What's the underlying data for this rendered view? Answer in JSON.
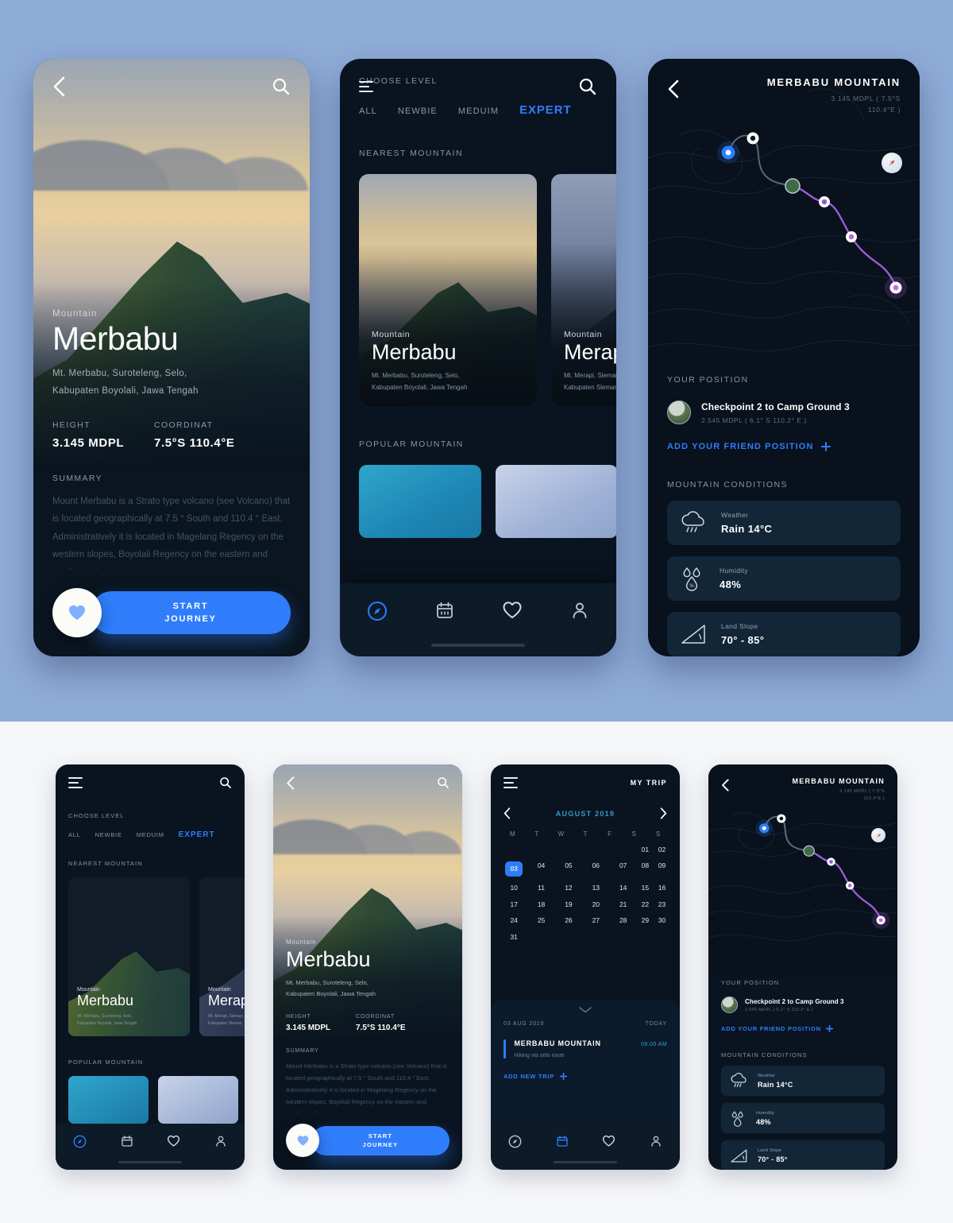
{
  "canvas": {
    "top_bg": "#8fabd8",
    "bottom_bg": "#f5f6f8",
    "accent": "#2f7dfb",
    "teal": "#2b9fc9"
  },
  "detail": {
    "back_icon": "chevron-left-icon",
    "search_icon": "search-icon",
    "kicker": "Mountain",
    "title": "Merbabu",
    "address_line1": "Mt. Merbabu, Suroteleng, Selo,",
    "address_line2": "Kabupaten Boyolali, Jawa Tengah",
    "height_label": "HEIGHT",
    "height_value": "3.145 MDPL",
    "coordinate_label": "COORDINAT",
    "coordinate_value": "7.5°S 110.4°E",
    "summary_label": "SUMMARY",
    "summary_body": "Mount Merbabu is a Strato type volcano (see Volcano) that is located geographically at 7.5 ° South and 110.4 ° East. Administratively it is located in Magelang Regency on the western slopes, Boyolali Regency on the eastern and southern slopes.",
    "favorite_icon": "heart-icon",
    "start_line1": "START",
    "start_line2": "JOURNEY"
  },
  "list": {
    "menu_icon": "hamburger-menu-icon",
    "search_icon": "search-icon",
    "choose_level_label": "CHOOSE LEVEL",
    "levels": [
      "ALL",
      "NEWBIE",
      "MEDUIM",
      "EXPERT"
    ],
    "active_level": "EXPERT",
    "nearest_label": "NEAREST MOUNTAIN",
    "nearest_cards": [
      {
        "kicker": "Mountain",
        "title": "Merbabu",
        "address_line1": "Mt. Merbabu, Suroteleng, Selo,",
        "address_line2": "Kabupaten Boyolali, Jawa Tengah"
      },
      {
        "kicker": "Mountain",
        "title": "Merapi",
        "address_line1": "Mt. Merapi, Sleman,",
        "address_line2": "Kabupaten Sleman, Yogyakarta"
      }
    ],
    "popular_label": "POPULAR MOUNTAIN",
    "tabs": [
      {
        "icon": "compass-icon",
        "active": true
      },
      {
        "icon": "calendar-icon",
        "active": false
      },
      {
        "icon": "heart-icon",
        "active": false
      },
      {
        "icon": "person-icon",
        "active": false
      }
    ]
  },
  "map": {
    "back_icon": "chevron-left-icon",
    "title": "MERBABU MOUNTAIN",
    "subtitle_line1": "3.145 MDPL ( 7.5°S",
    "subtitle_line2": "110.4°E )",
    "compass_icon": "compass-needle-icon",
    "position_label": "YOUR POSITION",
    "position_title": "Checkpoint 2 to Camp Ground 3",
    "position_sub": "2.545 MDPL ( 6.1° S 110.2° E )",
    "add_friend": "ADD YOUR FRIEND POSITION",
    "add_friend_icon": "plus-icon",
    "conditions_label": "MOUNTAIN CONDITIONS",
    "conditions": [
      {
        "icon": "rain-cloud-icon",
        "key": "Weather",
        "value": "Rain 14°C"
      },
      {
        "icon": "humidity-drop-icon",
        "key": "Humidity",
        "value": "48%"
      },
      {
        "icon": "slope-icon",
        "key": "Land Slope",
        "value": "70° - 85°"
      }
    ]
  },
  "calendar": {
    "menu_icon": "hamburger-menu-icon",
    "title": "MY TRIP",
    "prev_icon": "chevron-left-icon",
    "next_icon": "chevron-right-icon",
    "month": "AUGUST 2019",
    "weekdays": [
      "M",
      "T",
      "W",
      "T",
      "F",
      "S",
      "S"
    ],
    "leading_blanks": 5,
    "days": [
      "01",
      "02",
      "03",
      "04",
      "05",
      "06",
      "07",
      "08",
      "09",
      "10",
      "11",
      "12",
      "13",
      "14",
      "15",
      "16",
      "17",
      "18",
      "19",
      "20",
      "21",
      "22",
      "23",
      "24",
      "25",
      "26",
      "27",
      "28",
      "29",
      "30",
      "31"
    ],
    "selected_day": "03",
    "sheet_handle_icon": "chevron-down-icon",
    "sheet_date": "03 AUG 2019",
    "sheet_today": "TODAY",
    "trip_name": "MERBABU MOUNTAIN",
    "trip_time": "09.00 AM",
    "trip_sub": "Hiking via selo route",
    "add_trip": "ADD NEW TRIP",
    "add_trip_icon": "plus-icon"
  }
}
